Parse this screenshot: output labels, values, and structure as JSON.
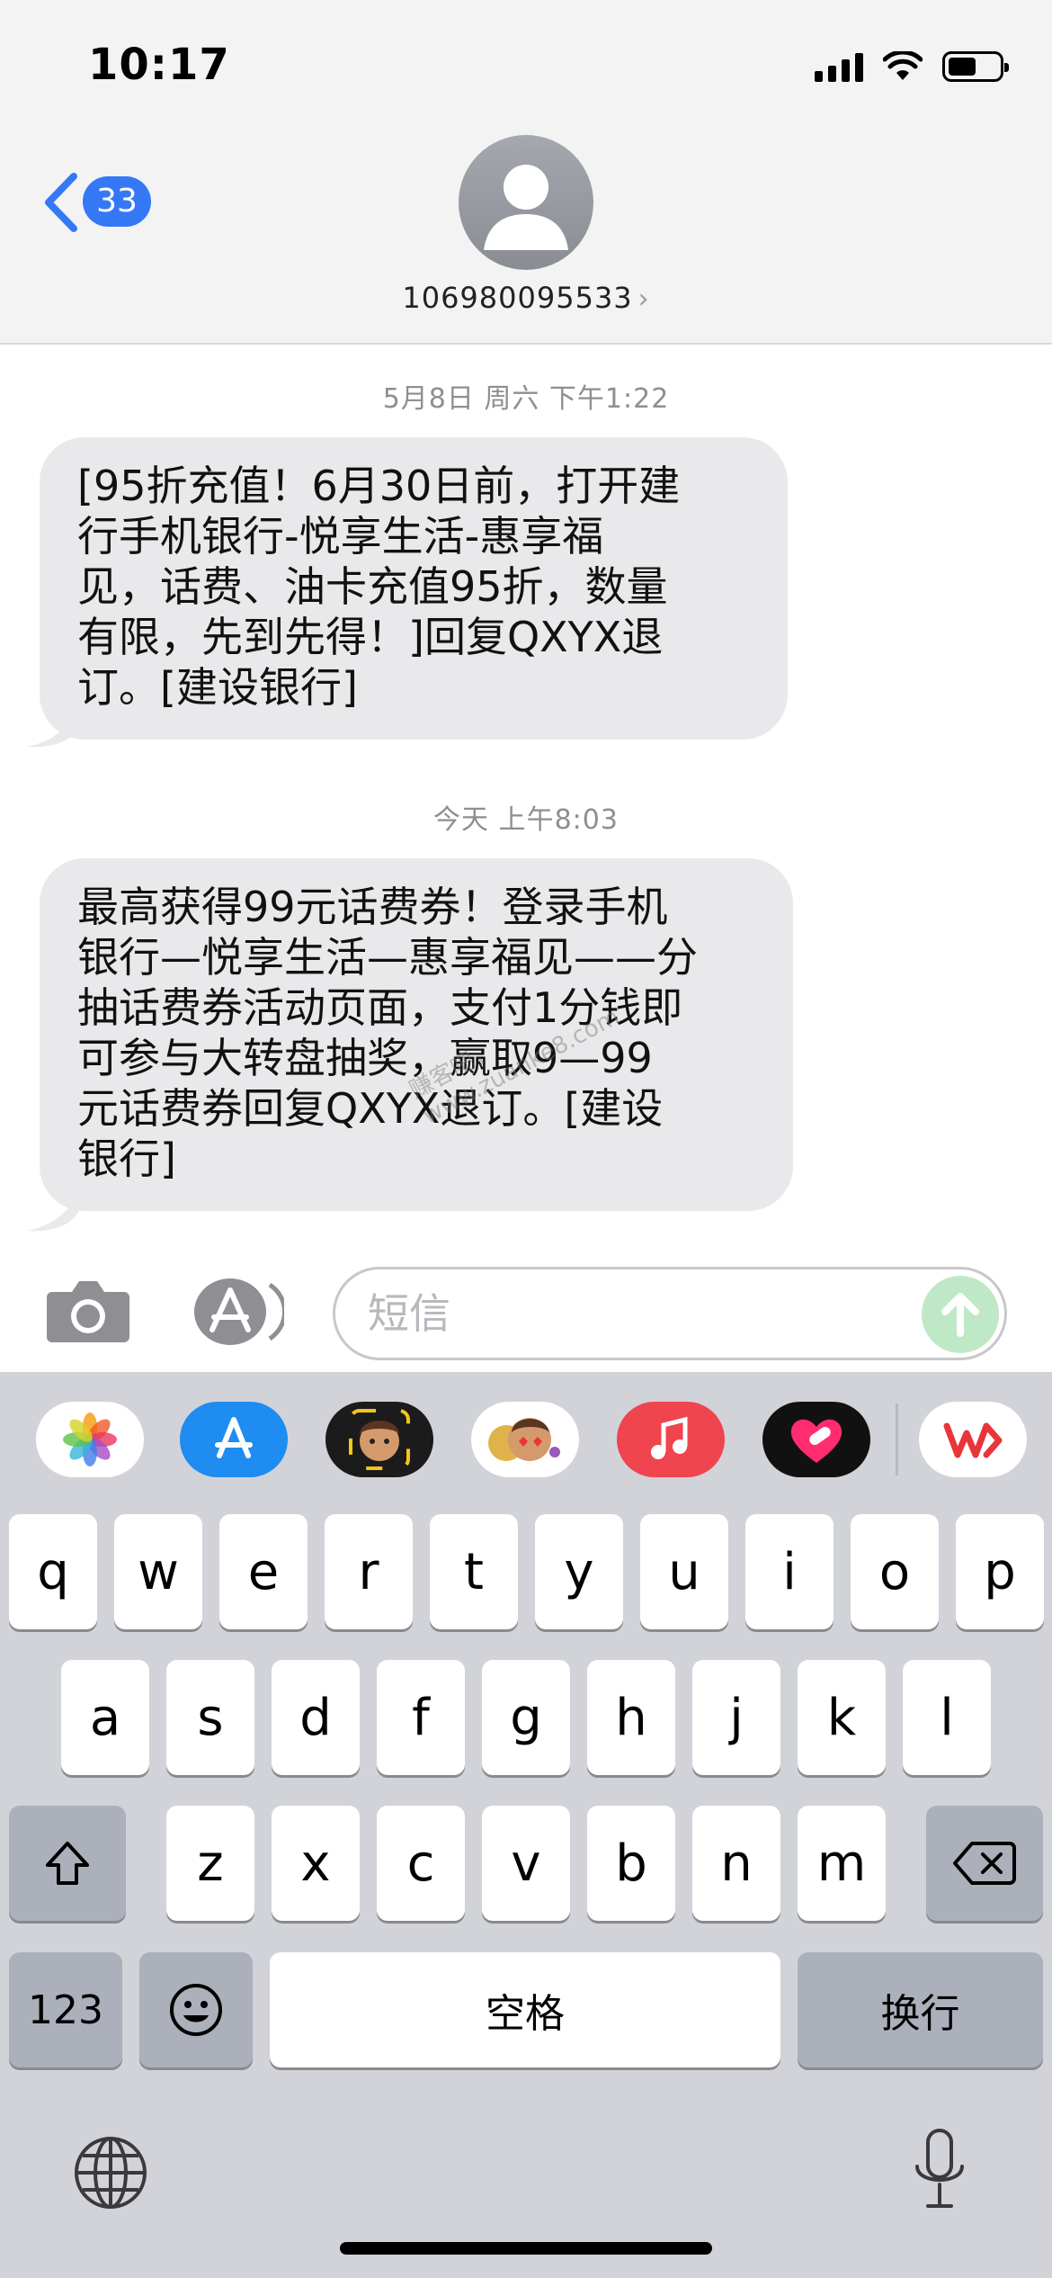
{
  "status_bar": {
    "time": "10:17"
  },
  "header": {
    "back_count": "33",
    "contact_number": "106980095533",
    "contact_chevron": "›"
  },
  "messages": [
    {
      "timestamp": "5月8日 周六 下午1:22",
      "lines": [
        "[95折充值！6月30日前，打开建",
        "行手机银行-悦享生活-惠享福",
        "见，话费、油卡充值95折，数量",
        "有限，先到先得！]回复QXYX退",
        "订。[建设银行]"
      ]
    },
    {
      "timestamp": "今天 上午8:03",
      "lines": [
        "最高获得99元话费券！登录手机",
        "银行—悦享生活—惠享福见——分",
        "抽话费券活动页面，支付1分钱即",
        "可参与大转盘抽奖，赢取9—99",
        "元话费券回复QXYX退订。[建设",
        "银行]"
      ]
    }
  ],
  "watermark": {
    "line1": "赚客吧，",
    "line2": "www.zuanke8.com"
  },
  "input": {
    "placeholder": "短信"
  },
  "app_drawer": [
    "photos-icon",
    "app-store-icon",
    "memoji-icon",
    "memoji-stickers-icon",
    "music-icon",
    "digital-touch-icon",
    "wps-icon"
  ],
  "keyboard": {
    "row1": [
      "q",
      "w",
      "e",
      "r",
      "t",
      "y",
      "u",
      "i",
      "o",
      "p"
    ],
    "row2": [
      "a",
      "s",
      "d",
      "f",
      "g",
      "h",
      "j",
      "k",
      "l"
    ],
    "row3": [
      "z",
      "x",
      "c",
      "v",
      "b",
      "n",
      "m"
    ],
    "numbers_label": "123",
    "space_label": "空格",
    "return_label": "换行"
  },
  "colors": {
    "imessage_blue": "#3478f6",
    "bubble_gray": "#e9e9eb",
    "keyboard_bg": "#d1d3d9"
  }
}
